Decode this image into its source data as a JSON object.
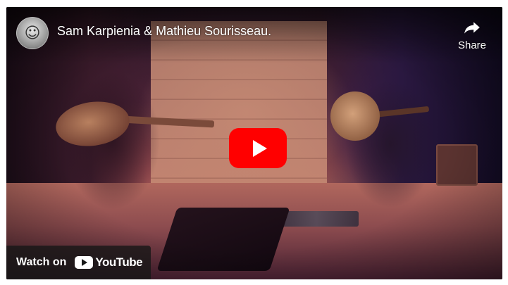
{
  "video": {
    "title": "Sam Karpienia & Mathieu Sourisseau.",
    "channel_avatar_icon": "channel-avatar"
  },
  "share": {
    "label": "Share",
    "icon": "share-arrow-icon"
  },
  "play_button": {
    "icon": "play-icon",
    "color": "#ff0000"
  },
  "watch_on": {
    "label": "Watch on",
    "brand": "YouTube",
    "brand_icon": "youtube-logo-icon"
  }
}
